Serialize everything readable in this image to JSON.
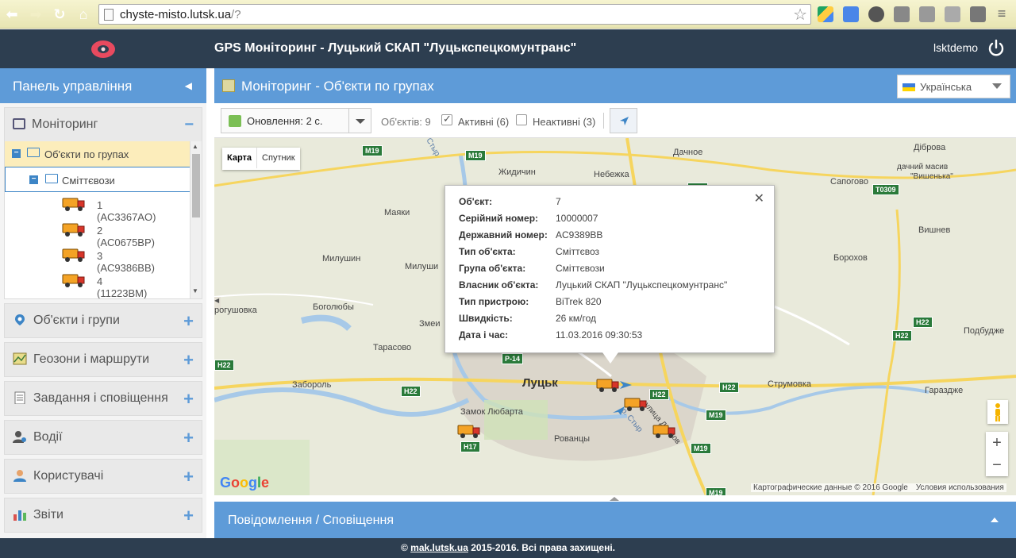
{
  "browser": {
    "url_host": "chyste-misto.lutsk.ua",
    "url_path": "/?"
  },
  "header": {
    "title": "GPS Моніторинг - Луцький СКАП \"Луцькспецкомунтранс\"",
    "username": "lsktdemo"
  },
  "sidebar": {
    "title": "Панель управління",
    "monitoring": {
      "label": "Моніторинг",
      "tree": {
        "groups_label": "Об'єкти по групах",
        "group_label": "Сміттєвози",
        "items": [
          {
            "label": "1 (AC3367AO)"
          },
          {
            "label": "2 (AC0675BP)"
          },
          {
            "label": "3 (AC9386BB)"
          },
          {
            "label": "4 (11223BM)"
          }
        ]
      }
    },
    "items": [
      {
        "label": "Об'єкти і групи"
      },
      {
        "label": "Геозони і маршрути"
      },
      {
        "label": "Завдання і сповіщення"
      },
      {
        "label": "Водії"
      },
      {
        "label": "Користувачі"
      },
      {
        "label": "Звіти"
      }
    ]
  },
  "main": {
    "title": "Моніторинг - Об'єкти по групах",
    "language": "Українська",
    "toolbar": {
      "refresh_label": "Оновлення: 2 с.",
      "objects_count": "Об'єктів: 9",
      "active_label": "Активні (6)",
      "inactive_label": "Неактивні (3)"
    }
  },
  "map": {
    "type_map": "Карта",
    "type_satellite": "Спутник",
    "attribution": "Картографические данные © 2016 Google",
    "terms": "Условия использования",
    "google": "Google",
    "labels": {
      "lutsk": "Луцьк",
      "zhydychyn": "Жидичин",
      "nebezhka": "Небежка",
      "dachnoe": "Дачное",
      "dibrova": "Діброва",
      "dacha_1": "дачний масив",
      "dacha_2": "\"Вишенька\"",
      "sapohovo": "Сапогово",
      "mayaki": "Маяки",
      "milushyn_w": "Милушин",
      "milushyn_e": "Милуши",
      "vyshniv": "Вишнев",
      "borokhov": "Борохов",
      "bogolyuby": "Боголюбы",
      "rohushivka": "рогушовка",
      "zmeinets": "Змеи",
      "tarasovo": "Тарасово",
      "zaborol": "Забороль",
      "zamok": "Замок Любарта",
      "rovantsy": "Рованцы",
      "strumivka": "Струмовка",
      "garazhdzha": "Гараздже",
      "podbuzhtsi": "Подбудже",
      "styr": "Стыр",
      "dubniv": "улица Дубнов",
      "r_styr": "р. Стыр"
    },
    "shields": {
      "m19": "M19",
      "h22": "H22",
      "p14": "P-14",
      "t0309": "T0309",
      "h17": "H17"
    }
  },
  "popup": {
    "rows": [
      {
        "k": "Об'єкт:",
        "v": "7"
      },
      {
        "k": "Серійний номер:",
        "v": "10000007"
      },
      {
        "k": "Державний номер:",
        "v": "AC9389BB"
      },
      {
        "k": "Тип об'єкта:",
        "v": "Сміттєвоз"
      },
      {
        "k": "Група об'єкта:",
        "v": "Сміттєвози"
      },
      {
        "k": "Власник об'єкта:",
        "v": "Луцький СКАП \"Луцькспецкомунтранс\""
      },
      {
        "k": "Тип пристрою:",
        "v": "BiTrek 820"
      },
      {
        "k": "Швидкість:",
        "v": "26 км/год"
      },
      {
        "k": "Дата і час:",
        "v": "11.03.2016 09:30:53"
      }
    ]
  },
  "notifications": {
    "title": "Повідомлення / Сповіщення"
  },
  "footer": {
    "prefix": "© ",
    "link": "mak.lutsk.ua",
    "suffix": " 2015-2016. Всі права захищені."
  }
}
